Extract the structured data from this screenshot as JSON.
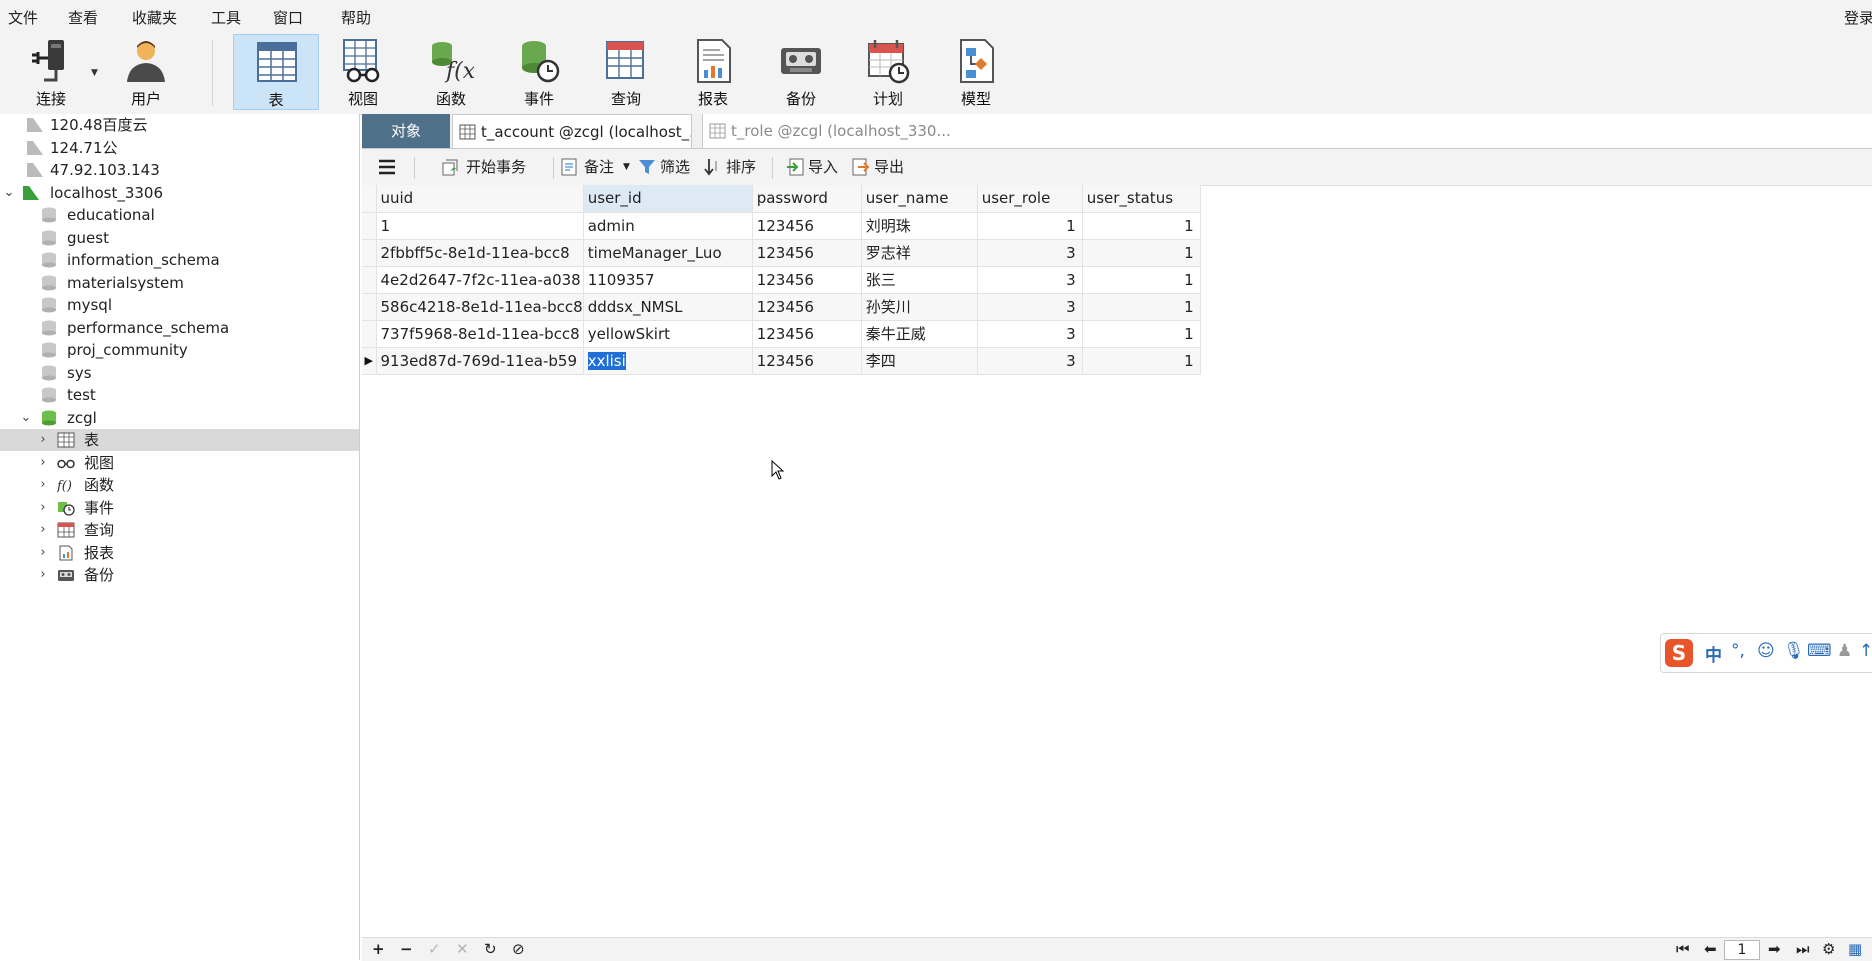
{
  "menu": [
    "文件",
    "查看",
    "收藏夹",
    "工具",
    "窗口",
    "帮助"
  ],
  "login_label": "登录",
  "toolbar": {
    "connect": "连接",
    "user": "用户",
    "table": "表",
    "view": "视图",
    "function": "函数",
    "event": "事件",
    "query": "查询",
    "report": "报表",
    "backup": "备份",
    "schedule": "计划",
    "model": "模型"
  },
  "tree": {
    "connections": [
      "120.48百度云",
      "124.71公",
      "47.92.103.143"
    ],
    "local": "localhost_3306",
    "databases": [
      "educational",
      "guest",
      "information_schema",
      "materialsystem",
      "mysql",
      "performance_schema",
      "proj_community",
      "sys",
      "test"
    ],
    "open_db": "zcgl",
    "objects": [
      "表",
      "视图",
      "函数",
      "事件",
      "查询",
      "报表",
      "备份"
    ]
  },
  "tabs": {
    "objects": "对象",
    "tab1": "t_account @zcgl (localhost_...",
    "tab2": "t_role @zcgl (localhost_330..."
  },
  "data_toolbar": {
    "begin_tx": "开始事务",
    "note": "备注",
    "filter": "筛选",
    "sort": "排序",
    "import": "导入",
    "export": "导出"
  },
  "grid": {
    "columns": [
      "uuid",
      "user_id",
      "password",
      "user_name",
      "user_role",
      "user_status"
    ],
    "rows": [
      [
        "1",
        "admin",
        "123456",
        "刘明珠",
        "1",
        "1"
      ],
      [
        "2fbbff5c-8e1d-11ea-bcc8",
        "timeManager_Luo",
        "123456",
        "罗志祥",
        "3",
        "1"
      ],
      [
        "4e2d2647-7f2c-11ea-a038",
        "1109357",
        "123456",
        "张三",
        "3",
        "1"
      ],
      [
        "586c4218-8e1d-11ea-bcc8",
        "dddsx_NMSL",
        "123456",
        "孙笑川",
        "3",
        "1"
      ],
      [
        "737f5968-8e1d-11ea-bcc8",
        "yellowSkirt",
        "123456",
        "秦牛正威",
        "3",
        "1"
      ],
      [
        "913ed87d-769d-11ea-b59",
        "xxlisi",
        "123456",
        "李四",
        "3",
        "1"
      ]
    ]
  },
  "status": {
    "page": "1"
  },
  "ime": {
    "logo": "S",
    "mode": "中"
  },
  "colors": {
    "accent_tab": "#4e7088",
    "selection": "#1f6fd6",
    "toolbar_active": "#cce4f7"
  }
}
